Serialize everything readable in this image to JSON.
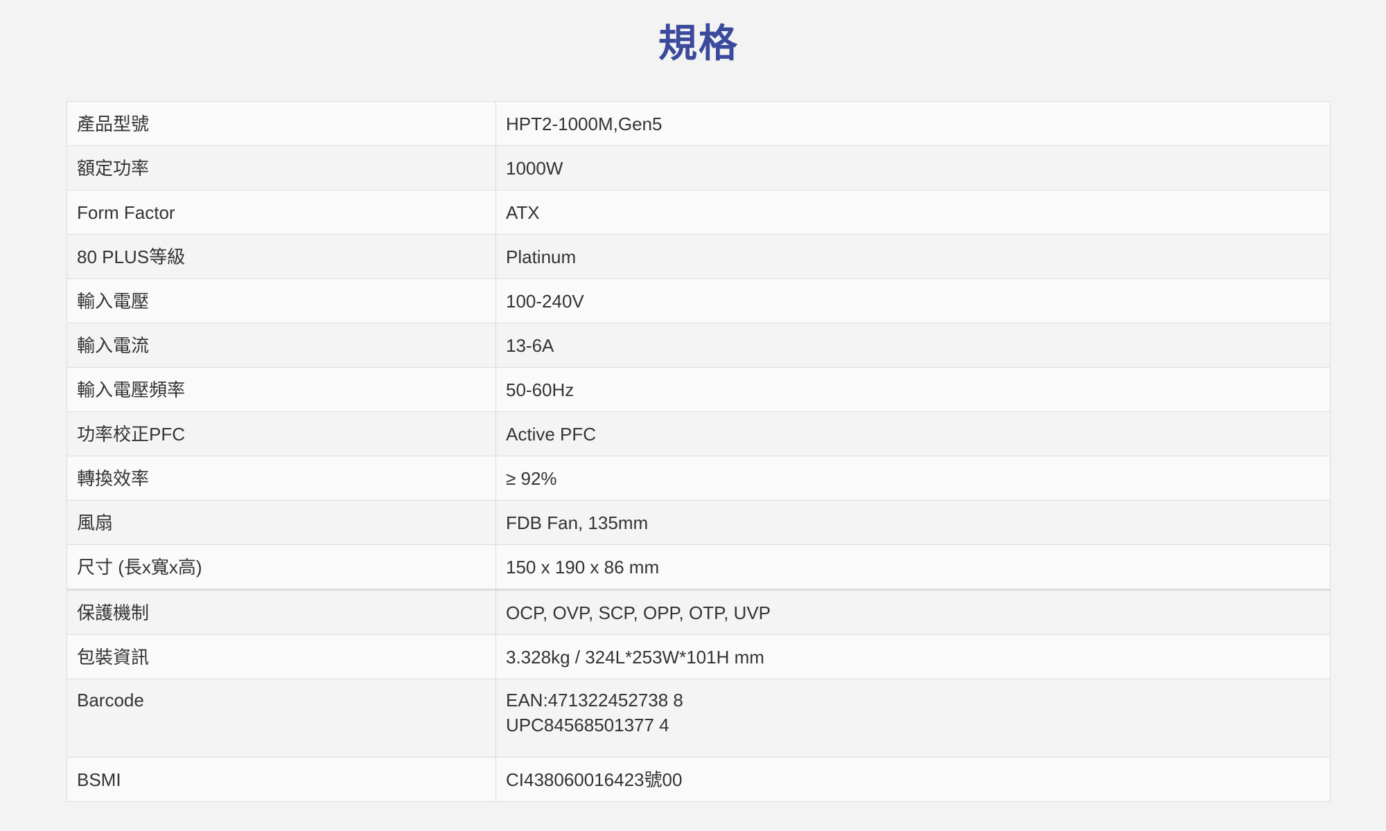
{
  "page": {
    "title": "規格"
  },
  "specs": {
    "rows": [
      {
        "label": "產品型號",
        "value": "HPT2-1000M,Gen5"
      },
      {
        "label": "額定功率",
        "value": "1000W"
      },
      {
        "label": "Form Factor",
        "value": "ATX"
      },
      {
        "label": "80 PLUS等級",
        "value": "Platinum"
      },
      {
        "label": "輸入電壓",
        "value": "100-240V"
      },
      {
        "label": "輸入電流",
        "value": "13-6A"
      },
      {
        "label": "輸入電壓頻率",
        "value": "50-60Hz"
      },
      {
        "label": "功率校正PFC",
        "value": "Active PFC"
      },
      {
        "label": "轉換效率",
        "value": "≥ 92%"
      },
      {
        "label": "風扇",
        "value": "FDB Fan, 135mm"
      },
      {
        "label": "尺寸 (長x寬x高)",
        "value": "150 x 190 x 86 mm"
      },
      {
        "label": "保護機制",
        "value": "OCP, OVP, SCP, OPP, OTP, UVP"
      },
      {
        "label": "包裝資訊",
        "value": "3.328kg / 324L*253W*101H mm"
      },
      {
        "label": "Barcode",
        "value_line1": "EAN:471322452738 8",
        "value_line2": "UPC84568501377 4"
      },
      {
        "label": "BSMI",
        "value": "CI438060016423號00"
      }
    ]
  }
}
